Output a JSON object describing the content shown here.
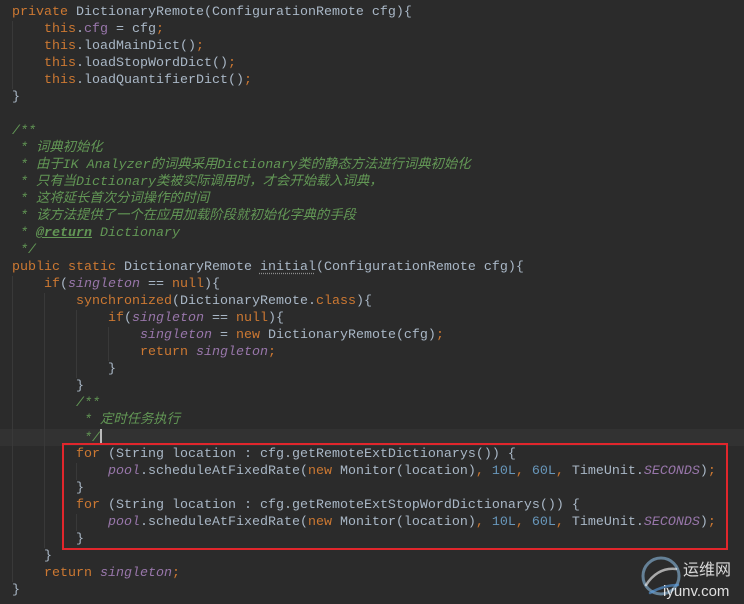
{
  "theme": {
    "background": "#2B2B2B",
    "current_line": "#323232",
    "text": "#A9B7C6",
    "keyword": "#CC7832",
    "field": "#9876AA",
    "number": "#6897BB",
    "doc_comment": "#629755",
    "underline": "#8C8C8C",
    "indent_guide": "#393939",
    "caret": "#BBBBBB",
    "annotation_box": "#E1262C"
  },
  "editor": {
    "lines": [
      {
        "tokens": [
          [
            "private",
            "keyword"
          ],
          [
            " DictionaryRemote(ConfigurationRemote cfg){",
            "plain"
          ]
        ]
      },
      {
        "tokens": [
          [
            "    ",
            "plain"
          ],
          [
            "this",
            "keyword"
          ],
          [
            ".",
            "plain"
          ],
          [
            "cfg",
            "field"
          ],
          [
            " = cfg",
            "plain"
          ],
          [
            ";",
            "keyword"
          ]
        ]
      },
      {
        "tokens": [
          [
            "    ",
            "plain"
          ],
          [
            "this",
            "keyword"
          ],
          [
            ".loadMainDict()",
            "plain"
          ],
          [
            ";",
            "keyword"
          ]
        ]
      },
      {
        "tokens": [
          [
            "    ",
            "plain"
          ],
          [
            "this",
            "keyword"
          ],
          [
            ".loadStopWordDict()",
            "plain"
          ],
          [
            ";",
            "keyword"
          ]
        ]
      },
      {
        "tokens": [
          [
            "    ",
            "plain"
          ],
          [
            "this",
            "keyword"
          ],
          [
            ".loadQuantifierDict()",
            "plain"
          ],
          [
            ";",
            "keyword"
          ]
        ]
      },
      {
        "tokens": [
          [
            "}",
            "plain"
          ]
        ]
      },
      {
        "tokens": []
      },
      {
        "tokens": [
          [
            "/**",
            "doc-comment"
          ]
        ]
      },
      {
        "tokens": [
          [
            " * 词典初始化",
            "doc-comment"
          ]
        ]
      },
      {
        "tokens": [
          [
            " * 由于IK Analyzer的词典采用Dictionary类的静态方法进行词典初始化",
            "doc-comment"
          ]
        ]
      },
      {
        "tokens": [
          [
            " * 只有当Dictionary类被实际调用时，才会开始载入词典，",
            "doc-comment"
          ]
        ]
      },
      {
        "tokens": [
          [
            " * 这将延长首次分词操作的时间",
            "doc-comment"
          ]
        ]
      },
      {
        "tokens": [
          [
            " * 该方法提供了一个在应用加载阶段就初始化字典的手段",
            "doc-comment"
          ]
        ]
      },
      {
        "tokens": [
          [
            " * ",
            "doc-comment"
          ],
          [
            "@return",
            "doc-tag"
          ],
          [
            " Dictionary",
            "doc-comment"
          ]
        ]
      },
      {
        "tokens": [
          [
            " */",
            "doc-comment"
          ]
        ]
      },
      {
        "tokens": [
          [
            "public static",
            "keyword"
          ],
          [
            " DictionaryRemote ",
            "plain"
          ],
          [
            "initial",
            "underlined"
          ],
          [
            "(ConfigurationRemote cfg){",
            "plain"
          ]
        ]
      },
      {
        "tokens": [
          [
            "    ",
            "plain"
          ],
          [
            "if",
            "keyword"
          ],
          [
            "(",
            "plain"
          ],
          [
            "singleton",
            "static-field"
          ],
          [
            " == ",
            "plain"
          ],
          [
            "null",
            "keyword"
          ],
          [
            "){",
            "plain"
          ]
        ]
      },
      {
        "tokens": [
          [
            "        ",
            "plain"
          ],
          [
            "synchronized",
            "keyword"
          ],
          [
            "(DictionaryRemote.",
            "plain"
          ],
          [
            "class",
            "keyword"
          ],
          [
            "){",
            "plain"
          ]
        ]
      },
      {
        "tokens": [
          [
            "            ",
            "plain"
          ],
          [
            "if",
            "keyword"
          ],
          [
            "(",
            "plain"
          ],
          [
            "singleton",
            "static-field"
          ],
          [
            " == ",
            "plain"
          ],
          [
            "null",
            "keyword"
          ],
          [
            "){",
            "plain"
          ]
        ]
      },
      {
        "tokens": [
          [
            "                ",
            "plain"
          ],
          [
            "singleton",
            "static-field"
          ],
          [
            " = ",
            "plain"
          ],
          [
            "new",
            "keyword"
          ],
          [
            " DictionaryRemote(cfg)",
            "plain"
          ],
          [
            ";",
            "keyword"
          ]
        ]
      },
      {
        "tokens": [
          [
            "                ",
            "plain"
          ],
          [
            "return ",
            "keyword"
          ],
          [
            "singleton",
            "static-field"
          ],
          [
            ";",
            "keyword"
          ]
        ]
      },
      {
        "tokens": [
          [
            "            ",
            "plain"
          ],
          [
            "}",
            "plain"
          ]
        ]
      },
      {
        "tokens": [
          [
            "        ",
            "plain"
          ],
          [
            "}",
            "plain"
          ]
        ]
      },
      {
        "tokens": [
          [
            "        ",
            "plain"
          ],
          [
            "/**",
            "doc-comment"
          ]
        ]
      },
      {
        "tokens": [
          [
            "        ",
            "plain"
          ],
          [
            " * 定时任务执行",
            "doc-comment"
          ]
        ]
      },
      {
        "tokens": [
          [
            "        ",
            "plain"
          ],
          [
            " */",
            "doc-comment"
          ]
        ],
        "current": true
      },
      {
        "tokens": [
          [
            "        ",
            "plain"
          ],
          [
            "for ",
            "keyword"
          ],
          [
            "(String location : cfg.getRemoteExtDictionarys()) {",
            "plain"
          ]
        ]
      },
      {
        "tokens": [
          [
            "            ",
            "plain"
          ],
          [
            "pool",
            "static-field"
          ],
          [
            ".scheduleAtFixedRate(",
            "plain"
          ],
          [
            "new",
            "keyword"
          ],
          [
            " Monitor(location)",
            "plain"
          ],
          [
            ",",
            "keyword"
          ],
          [
            " 10L",
            "number"
          ],
          [
            ",",
            "keyword"
          ],
          [
            " 60L",
            "number"
          ],
          [
            ",",
            "keyword"
          ],
          [
            " TimeUnit.",
            "plain"
          ],
          [
            "SECONDS",
            "static-field"
          ],
          [
            ")",
            "plain"
          ],
          [
            ";",
            "keyword"
          ]
        ]
      },
      {
        "tokens": [
          [
            "        ",
            "plain"
          ],
          [
            "}",
            "plain"
          ]
        ]
      },
      {
        "tokens": [
          [
            "        ",
            "plain"
          ],
          [
            "for ",
            "keyword"
          ],
          [
            "(String location : cfg.getRemoteExtStopWordDictionarys()) {",
            "plain"
          ]
        ]
      },
      {
        "tokens": [
          [
            "            ",
            "plain"
          ],
          [
            "pool",
            "static-field"
          ],
          [
            ".scheduleAtFixedRate(",
            "plain"
          ],
          [
            "new",
            "keyword"
          ],
          [
            " Monitor(location)",
            "plain"
          ],
          [
            ",",
            "keyword"
          ],
          [
            " 10L",
            "number"
          ],
          [
            ",",
            "keyword"
          ],
          [
            " 60L",
            "number"
          ],
          [
            ",",
            "keyword"
          ],
          [
            " TimeUnit.",
            "plain"
          ],
          [
            "SECONDS",
            "static-field"
          ],
          [
            ")",
            "plain"
          ],
          [
            ";",
            "keyword"
          ]
        ]
      },
      {
        "tokens": [
          [
            "        ",
            "plain"
          ],
          [
            "}",
            "plain"
          ]
        ]
      },
      {
        "tokens": [
          [
            "    ",
            "plain"
          ],
          [
            "}",
            "plain"
          ]
        ]
      },
      {
        "tokens": [
          [
            "    ",
            "plain"
          ],
          [
            "return ",
            "keyword"
          ],
          [
            "singleton",
            "static-field"
          ],
          [
            ";",
            "keyword"
          ]
        ]
      },
      {
        "tokens": [
          [
            "}",
            "plain"
          ]
        ]
      }
    ]
  },
  "watermark": {
    "name": "运维网",
    "site": "iyunv.com"
  }
}
